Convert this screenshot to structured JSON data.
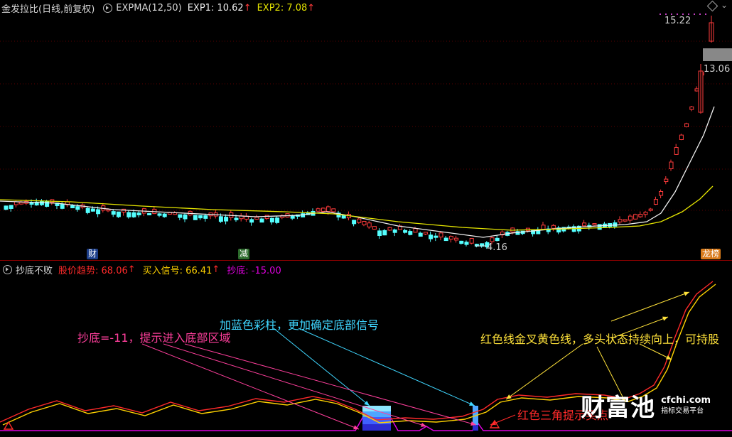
{
  "top_header": {
    "title": "金发拉比(日线,前复权)",
    "indicator": "EXPMA(12,50)",
    "exp1": "EXP1: 10.62",
    "exp2": "EXP2: 7.08",
    "arrow": "↑"
  },
  "price_labels": {
    "high": "15.22",
    "last": "13.06",
    "low": "4.16"
  },
  "markers": {
    "cai": "财",
    "jian": "减",
    "longhu": "龙榜"
  },
  "bottom_header": {
    "title": "抄底不败",
    "trend": "股价趋势: 68.06",
    "buy": "买入信号: 66.41",
    "dip": "抄底: -15.00",
    "arrow": "↑"
  },
  "annotations": {
    "blue_bar": "加蓝色彩柱，更加确定底部信号",
    "dip_hint": "抄底=-11，提示进入底部区域",
    "golden_cross": "红色线金叉黄色线，多头状态持续向上，可持股",
    "red_triangle": "红色三角提示买点"
  },
  "watermark": {
    "brand": "财富池",
    "domain": "cfchi.com",
    "slogan": "指标交易平台"
  },
  "colors": {
    "up": "#ff3b3b",
    "down": "#54ffff",
    "exp1": "#f0f0f0",
    "exp2": "#e6e600",
    "trend": "#ff2a2a",
    "buy": "#ffd200",
    "dip": "#e000e0",
    "annotation_cyan": "#3fd6ff",
    "annotation_pink": "#ff3f9c",
    "annotation_yellow": "#ffe23a"
  }
}
